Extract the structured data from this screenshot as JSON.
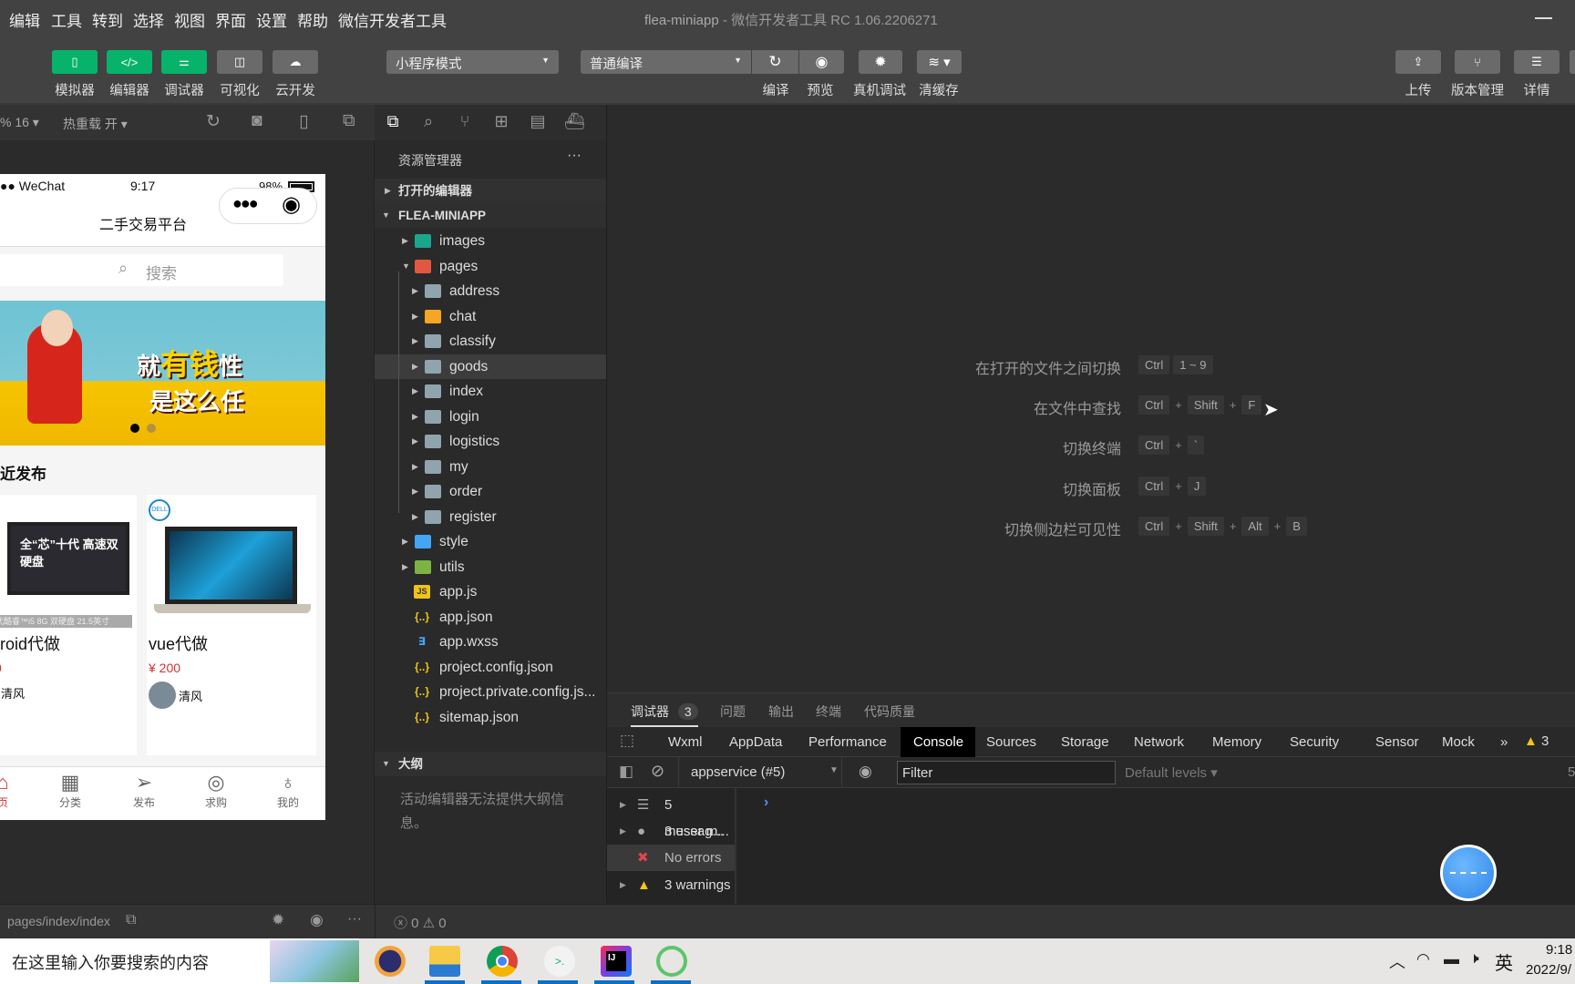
{
  "menu": [
    "编辑",
    "工具",
    "转到",
    "选择",
    "视图",
    "界面",
    "设置",
    "帮助",
    "微信开发者工具"
  ],
  "window_title": {
    "project": "flea-miniapp",
    "separator": " - ",
    "app": "微信开发者工具 RC 1.06.2206271"
  },
  "toolbar": {
    "left_buttons": [
      {
        "label": "模拟器",
        "icon": "phone-icon"
      },
      {
        "label": "编辑器",
        "icon": "code-icon"
      },
      {
        "label": "调试器",
        "icon": "debug-sliders-icon"
      },
      {
        "label": "可视化",
        "icon": "layout-icon"
      },
      {
        "label": "云开发",
        "icon": "cloud-icon"
      }
    ],
    "mode_select": "小程序模式",
    "compile_select": "普通编译",
    "center_labels": [
      "编译",
      "预览",
      "真机调试",
      "清缓存"
    ],
    "right_buttons": [
      {
        "label": "上传",
        "icon": "upload-icon"
      },
      {
        "label": "版本管理",
        "icon": "branch-icon"
      },
      {
        "label": "详情",
        "icon": "menu-icon"
      }
    ],
    "accent": "#07b36b"
  },
  "simulator": {
    "zoom": "% 16 ▾",
    "hot_reload": "热重载 开 ▾",
    "status": {
      "carrier": "●● WeChat",
      "time": "9:17",
      "battery": "98%"
    },
    "nav_title": "二手交易平台",
    "search_placeholder": "搜索",
    "banner_text": [
      "就",
      "有钱",
      "性",
      "是这么任"
    ],
    "section_title": "近发布",
    "cards": [
      {
        "image_text": "全“芯”十代 高速双硬盘",
        "caption": "代酷睿™i5 8G 双硬盘 21.5英寸",
        "title": "roid代做",
        "price": "0",
        "user": "清风"
      },
      {
        "title": "vue代做",
        "price": "¥ 200",
        "user": "清风",
        "brand": "DELL"
      }
    ],
    "tabbar": [
      {
        "label": "页",
        "icon": "home-icon",
        "active": true
      },
      {
        "label": "分类",
        "icon": "grid-icon"
      },
      {
        "label": "发布",
        "icon": "send-icon"
      },
      {
        "label": "求购",
        "icon": "target-icon"
      },
      {
        "label": "我的",
        "icon": "user-icon"
      }
    ],
    "path": "pages/index/index"
  },
  "explorer": {
    "title": "资源管理器",
    "more": "···",
    "open_editors": "打开的编辑器",
    "project": "FLEA-MINIAPP",
    "tree": [
      {
        "name": "images",
        "level": 1,
        "folder": true,
        "open": false,
        "color": "#1aa58d"
      },
      {
        "name": "pages",
        "level": 1,
        "folder": true,
        "open": true,
        "color": "#e2583e"
      },
      {
        "name": "address",
        "level": 2,
        "folder": true,
        "color": "#90a4ae"
      },
      {
        "name": "chat",
        "level": 2,
        "folder": true,
        "color": "#f5a623"
      },
      {
        "name": "classify",
        "level": 2,
        "folder": true,
        "color": "#90a4ae"
      },
      {
        "name": "goods",
        "level": 2,
        "folder": true,
        "color": "#90a4ae",
        "selected": true
      },
      {
        "name": "index",
        "level": 2,
        "folder": true,
        "color": "#90a4ae"
      },
      {
        "name": "login",
        "level": 2,
        "folder": true,
        "color": "#90a4ae"
      },
      {
        "name": "logistics",
        "level": 2,
        "folder": true,
        "color": "#90a4ae"
      },
      {
        "name": "my",
        "level": 2,
        "folder": true,
        "color": "#90a4ae"
      },
      {
        "name": "order",
        "level": 2,
        "folder": true,
        "color": "#90a4ae"
      },
      {
        "name": "register",
        "level": 2,
        "folder": true,
        "color": "#90a4ae"
      },
      {
        "name": "style",
        "level": 1,
        "folder": true,
        "color": "#42a5f5"
      },
      {
        "name": "utils",
        "level": 1,
        "folder": true,
        "color": "#7cb342"
      },
      {
        "name": "app.js",
        "level": 1,
        "glyph": "JS",
        "color": "#f0c419"
      },
      {
        "name": "app.json",
        "level": 1,
        "glyph": "{..}",
        "color": "#f0c419"
      },
      {
        "name": "app.wxss",
        "level": 1,
        "glyph": "∃",
        "color": "#42a5f5"
      },
      {
        "name": "project.config.json",
        "level": 1,
        "glyph": "{..}",
        "color": "#f0c419"
      },
      {
        "name": "project.private.config.js...",
        "level": 1,
        "glyph": "{..}",
        "color": "#f0c419"
      },
      {
        "name": "sitemap.json",
        "level": 1,
        "glyph": "{..}",
        "color": "#f0c419"
      }
    ],
    "outline_title": "大纲",
    "outline_empty": "活动编辑器无法提供大纲信息。",
    "problems": "ⓧ 0 ⚠ 0"
  },
  "shortcuts": [
    {
      "label": "在打开的文件之间切换",
      "keys": [
        "Ctrl",
        "1 ~ 9"
      ],
      "sep": ""
    },
    {
      "label": "在文件中查找",
      "keys": [
        "Ctrl",
        "Shift",
        "F"
      ],
      "sep": "+"
    },
    {
      "label": "切换终端",
      "keys": [
        "Ctrl",
        "`"
      ],
      "sep": "+"
    },
    {
      "label": "切换面板",
      "keys": [
        "Ctrl",
        "J"
      ],
      "sep": "+"
    },
    {
      "label": "切换侧边栏可见性",
      "keys": [
        "Ctrl",
        "Shift",
        "Alt",
        "B"
      ],
      "sep": "+"
    }
  ],
  "devtools": {
    "top_tabs": [
      {
        "label": "调试器",
        "badge": "3"
      },
      {
        "label": "问题"
      },
      {
        "label": "输出"
      },
      {
        "label": "终端"
      },
      {
        "label": "代码质量"
      }
    ],
    "tabs": [
      "Wxml",
      "AppData",
      "Performance",
      "Console",
      "Sources",
      "Storage",
      "Network",
      "Memory",
      "Security",
      "Sensor",
      "Mock"
    ],
    "active_tab": "Console",
    "more": "»",
    "warning_count": "3",
    "context": "appservice (#5)",
    "filter_placeholder": "Filter",
    "levels": "Default levels ▾",
    "hidden_count": "5",
    "sidebar": [
      {
        "label": "5 messag...",
        "icon": "list-icon"
      },
      {
        "label": "3 user m...",
        "icon": "user-circle-icon"
      },
      {
        "label": "No errors",
        "icon": "error-icon",
        "selected": true
      },
      {
        "label": "3 warnings",
        "icon": "warning-icon"
      }
    ],
    "prompt": "›"
  },
  "taskbar": {
    "search_placeholder": "在这里输入你要搜索的内容",
    "apps": [
      "eclipse-icon",
      "file-explorer-icon",
      "chrome-icon",
      "wechat-devtools-icon",
      "intellij-icon",
      "navicat-icon"
    ],
    "ime": "英",
    "time": "9:18",
    "date": "2022/9/"
  }
}
